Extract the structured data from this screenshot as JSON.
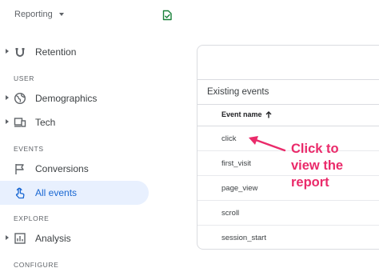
{
  "header": {
    "reporting_label": "Reporting"
  },
  "sidebar": {
    "items": [
      {
        "label": "Retention"
      },
      {
        "label": "Demographics"
      },
      {
        "label": "Tech"
      },
      {
        "label": "Conversions"
      },
      {
        "label": "All events"
      },
      {
        "label": "Analysis"
      }
    ],
    "sections": {
      "user": "USER",
      "events": "EVENTS",
      "explore": "EXPLORE",
      "configure": "CONFIGURE"
    },
    "active_item": "All events"
  },
  "events_card": {
    "title": "Existing events",
    "column_header": "Event name",
    "sort_icon": "arrow-up-icon",
    "rows": [
      {
        "name": "click"
      },
      {
        "name": "first_visit"
      },
      {
        "name": "page_view"
      },
      {
        "name": "scroll"
      },
      {
        "name": "session_start"
      }
    ]
  },
  "annotation": {
    "text": "Click to\nview the\nreport",
    "color": "#ea2a6a"
  },
  "colors": {
    "accent": "#1967d2",
    "active_bg": "#e8f0fe",
    "doc_icon": "#188038"
  }
}
